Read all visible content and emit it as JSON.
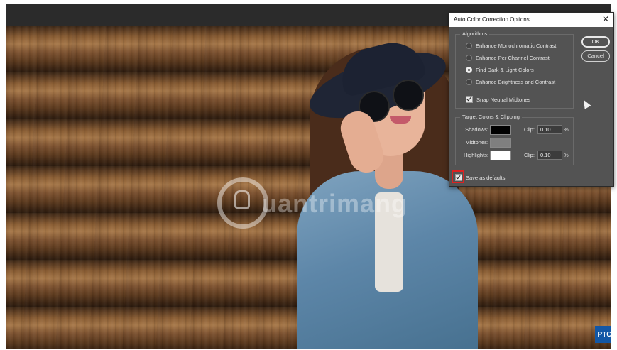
{
  "dialog": {
    "title": "Auto Color Correction Options",
    "close_glyph": "✕",
    "algorithms": {
      "label": "Algorithms",
      "options": [
        {
          "label": "Enhance Monochromatic Contrast",
          "selected": false
        },
        {
          "label": "Enhance Per Channel Contrast",
          "selected": false
        },
        {
          "label": "Find Dark & Light Colors",
          "selected": true
        },
        {
          "label": "Enhance Brightness and Contrast",
          "selected": false
        }
      ],
      "snap_label": "Snap Neutral Midtones",
      "snap_checked": true
    },
    "target": {
      "label": "Target Colors & Clipping",
      "shadows": {
        "label": "Shadows:",
        "color": "#000000",
        "clip_label": "Clip:",
        "clip_value": "0.10",
        "unit": "%"
      },
      "midtones": {
        "label": "Midtones:",
        "color": "#7f7f7f"
      },
      "highlights": {
        "label": "Highlights:",
        "color": "#ffffff",
        "clip_label": "Clip:",
        "clip_value": "0.10",
        "unit": "%"
      }
    },
    "save_defaults": {
      "label": "Save as defaults",
      "checked": true
    },
    "buttons": {
      "ok": "OK",
      "cancel": "Cancel"
    }
  },
  "watermark": {
    "text": "uantrimang"
  },
  "badge": {
    "text": "PTC"
  },
  "colors": {
    "accent": "#1357a6",
    "highlight_box": "#dd2222"
  }
}
